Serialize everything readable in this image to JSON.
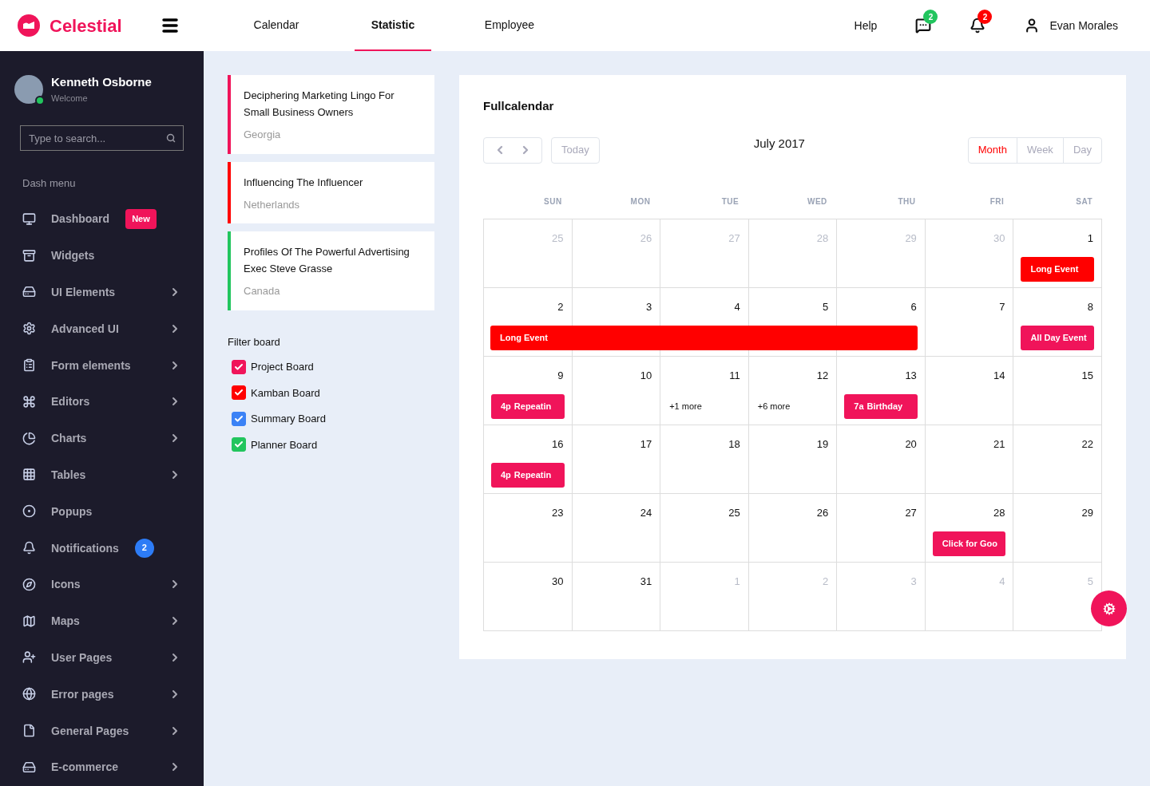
{
  "brand": {
    "name": "Celestial"
  },
  "top_nav": {
    "tabs": [
      {
        "label": "Calendar",
        "selected": false
      },
      {
        "label": "Statistic",
        "selected": true
      },
      {
        "label": "Employee",
        "selected": false
      }
    ],
    "help": "Help",
    "alerts": [
      {
        "kind": "messages",
        "count": "2",
        "color": "#22c55e"
      },
      {
        "kind": "bell",
        "count": "2",
        "color": "#ff0000"
      }
    ],
    "user": "Evan Morales"
  },
  "sidebar": {
    "profile": {
      "name": "Kenneth Osborne",
      "subtitle": "Welcome",
      "online": true
    },
    "search": {
      "placeholder": "Type to search..."
    },
    "heading": "Dash menu",
    "items": [
      {
        "label": "Dashboard",
        "has_submenu": false,
        "badge": {
          "text": "New",
          "kind": "label"
        }
      },
      {
        "label": "Widgets",
        "has_submenu": false
      },
      {
        "label": "UI Elements",
        "has_submenu": true
      },
      {
        "label": "Advanced UI",
        "has_submenu": true
      },
      {
        "label": "Form elements",
        "has_submenu": true
      },
      {
        "label": "Editors",
        "has_submenu": true
      },
      {
        "label": "Charts",
        "has_submenu": true
      },
      {
        "label": "Tables",
        "has_submenu": true
      },
      {
        "label": "Popups",
        "has_submenu": false
      },
      {
        "label": "Notifications",
        "has_submenu": false,
        "badge": {
          "text": "2",
          "kind": "count"
        }
      },
      {
        "label": "Icons",
        "has_submenu": true
      },
      {
        "label": "Maps",
        "has_submenu": true
      },
      {
        "label": "User Pages",
        "has_submenu": true
      },
      {
        "label": "Error pages",
        "has_submenu": true
      },
      {
        "label": "General Pages",
        "has_submenu": true
      },
      {
        "label": "E-commerce",
        "has_submenu": true
      }
    ]
  },
  "posts": [
    {
      "title": "Deciphering Marketing Lingo For Small Business Owners",
      "location": "Georgia",
      "color": "#f0145a"
    },
    {
      "title": "Influencing The Influencer",
      "location": "Netherlands",
      "color": "#ff0000"
    },
    {
      "title": "Profiles Of The Powerful Advertising Exec Steve Grasse",
      "location": "Canada",
      "color": "#22c55e"
    }
  ],
  "filter_board": {
    "title": "Filter board",
    "boards": [
      {
        "label": "Project Board",
        "checked": true,
        "color": "#f0145a"
      },
      {
        "label": "Kamban Board",
        "checked": true,
        "color": "#ff0000"
      },
      {
        "label": "Summary Board",
        "checked": true,
        "color": "#3b82f6"
      },
      {
        "label": "Planner Board",
        "checked": true,
        "color": "#22c55e"
      }
    ]
  },
  "calendar": {
    "title": "Fullcalendar",
    "today": "Today",
    "month_label": "July 2017",
    "views": [
      {
        "label": "Month",
        "selected": true
      },
      {
        "label": "Week",
        "selected": false
      },
      {
        "label": "Day",
        "selected": false
      }
    ],
    "weekdays": [
      "SUN",
      "MON",
      "TUE",
      "WED",
      "THU",
      "FRI",
      "SAT"
    ],
    "weeks": [
      {
        "days": [
          {
            "num": "25",
            "muted": true
          },
          {
            "num": "26",
            "muted": true
          },
          {
            "num": "27",
            "muted": true
          },
          {
            "num": "28",
            "muted": true
          },
          {
            "num": "29",
            "muted": true
          },
          {
            "num": "30",
            "muted": true
          },
          {
            "num": "1",
            "muted": false,
            "events": [
              {
                "kind": "event",
                "title": "Long Event",
                "color": "#ff0000"
              }
            ]
          }
        ]
      },
      {
        "days": [
          {
            "num": "2",
            "muted": false,
            "events": [
              {
                "kind": "bar_start",
                "title": "Long Event",
                "color": "#ff0000"
              }
            ]
          },
          {
            "num": "3",
            "muted": false,
            "events": [
              {
                "kind": "bar_mid",
                "color": "#ff0000"
              }
            ]
          },
          {
            "num": "4",
            "muted": false,
            "events": [
              {
                "kind": "bar_mid",
                "color": "#ff0000"
              }
            ]
          },
          {
            "num": "5",
            "muted": false,
            "events": [
              {
                "kind": "bar_mid",
                "color": "#ff0000"
              }
            ]
          },
          {
            "num": "6",
            "muted": false,
            "events": [
              {
                "kind": "bar_end",
                "color": "#ff0000"
              }
            ]
          },
          {
            "num": "7",
            "muted": false
          },
          {
            "num": "8",
            "muted": false,
            "events": [
              {
                "kind": "event",
                "title": "All Day Event",
                "color": "#f0145a"
              }
            ]
          }
        ]
      },
      {
        "days": [
          {
            "num": "9",
            "muted": false,
            "events": [
              {
                "kind": "event",
                "time": "4p",
                "title": "Repeatin",
                "color": "#f0145a"
              }
            ]
          },
          {
            "num": "10",
            "muted": false
          },
          {
            "num": "11",
            "muted": false,
            "events": [
              {
                "kind": "more",
                "title": "+1 more"
              }
            ]
          },
          {
            "num": "12",
            "muted": false,
            "events": [
              {
                "kind": "more",
                "title": "+6 more"
              }
            ]
          },
          {
            "num": "13",
            "muted": false,
            "events": [
              {
                "kind": "event",
                "time": "7a",
                "title": "Birthday",
                "color": "#f0145a"
              }
            ]
          },
          {
            "num": "14",
            "muted": false
          },
          {
            "num": "15",
            "muted": false
          }
        ]
      },
      {
        "days": [
          {
            "num": "16",
            "muted": false,
            "events": [
              {
                "kind": "event",
                "time": "4p",
                "title": "Repeatin",
                "color": "#f0145a"
              }
            ]
          },
          {
            "num": "17",
            "muted": false
          },
          {
            "num": "18",
            "muted": false
          },
          {
            "num": "19",
            "muted": false
          },
          {
            "num": "20",
            "muted": false
          },
          {
            "num": "21",
            "muted": false
          },
          {
            "num": "22",
            "muted": false
          }
        ]
      },
      {
        "days": [
          {
            "num": "23",
            "muted": false
          },
          {
            "num": "24",
            "muted": false
          },
          {
            "num": "25",
            "muted": false
          },
          {
            "num": "26",
            "muted": false
          },
          {
            "num": "27",
            "muted": false
          },
          {
            "num": "28",
            "muted": false,
            "events": [
              {
                "kind": "event",
                "title": "Click for Goo",
                "color": "#f0145a"
              }
            ]
          },
          {
            "num": "29",
            "muted": false
          }
        ]
      },
      {
        "days": [
          {
            "num": "30",
            "muted": false
          },
          {
            "num": "31",
            "muted": false
          },
          {
            "num": "1",
            "muted": true
          },
          {
            "num": "2",
            "muted": true
          },
          {
            "num": "3",
            "muted": true
          },
          {
            "num": "4",
            "muted": true
          },
          {
            "num": "5",
            "muted": true
          }
        ]
      }
    ]
  }
}
